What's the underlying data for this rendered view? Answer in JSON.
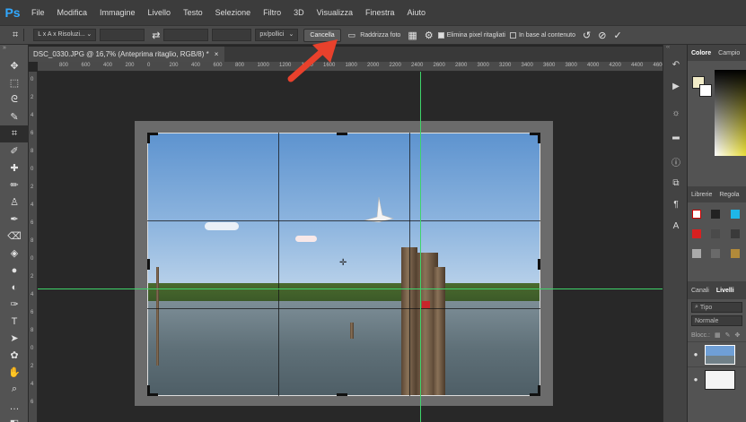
{
  "app": {
    "logo": "Ps",
    "accent": "#31a8ff"
  },
  "menu": [
    "File",
    "Modifica",
    "Immagine",
    "Livello",
    "Testo",
    "Selezione",
    "Filtro",
    "3D",
    "Visualizza",
    "Finestra",
    "Aiuto"
  ],
  "options": {
    "ratio_select": "L x A x Risoluzi...",
    "unit_select": "px/pollici",
    "cancel_label": "Cancella",
    "straighten_label": "Raddrizza foto",
    "delete_pixels_label": "Elimina pixel ritagliati",
    "delete_pixels_checked": true,
    "content_aware_label": "In base al contenuto",
    "content_aware_checked": false
  },
  "document": {
    "tab_title": "DSC_0330.JPG @ 16,7% (Anteprima ritaglio, RGB/8) *",
    "close_glyph": "×"
  },
  "ruler_top_labels": [
    "800",
    "600",
    "400",
    "200",
    "0",
    "200",
    "400",
    "600",
    "800",
    "1000",
    "1200",
    "1400",
    "1600",
    "1800",
    "2000",
    "2200",
    "2400",
    "2600",
    "2800",
    "3000",
    "3200",
    "3400",
    "3600",
    "3800",
    "4000",
    "4200",
    "4400",
    "4600"
  ],
  "ruler_left_labels": [
    "0",
    "2",
    "4",
    "6",
    "8",
    "0",
    "2",
    "4",
    "6",
    "8",
    "0",
    "2",
    "4",
    "6",
    "8",
    "0",
    "2",
    "4",
    "6"
  ],
  "panels": {
    "color_tabs": [
      "Colore",
      "Campio"
    ],
    "library_tabs": [
      "Librerie",
      "Regola"
    ],
    "layer_tabs": [
      "Canali",
      "Livelli"
    ],
    "search_placeholder": "Tipo",
    "blend_mode": "Normale",
    "lock_label": "Blocc.:"
  },
  "colors": {
    "guide": "#3fd46a",
    "foreground": "#f2ecc8",
    "cancel_arrow": "#e8412c"
  }
}
